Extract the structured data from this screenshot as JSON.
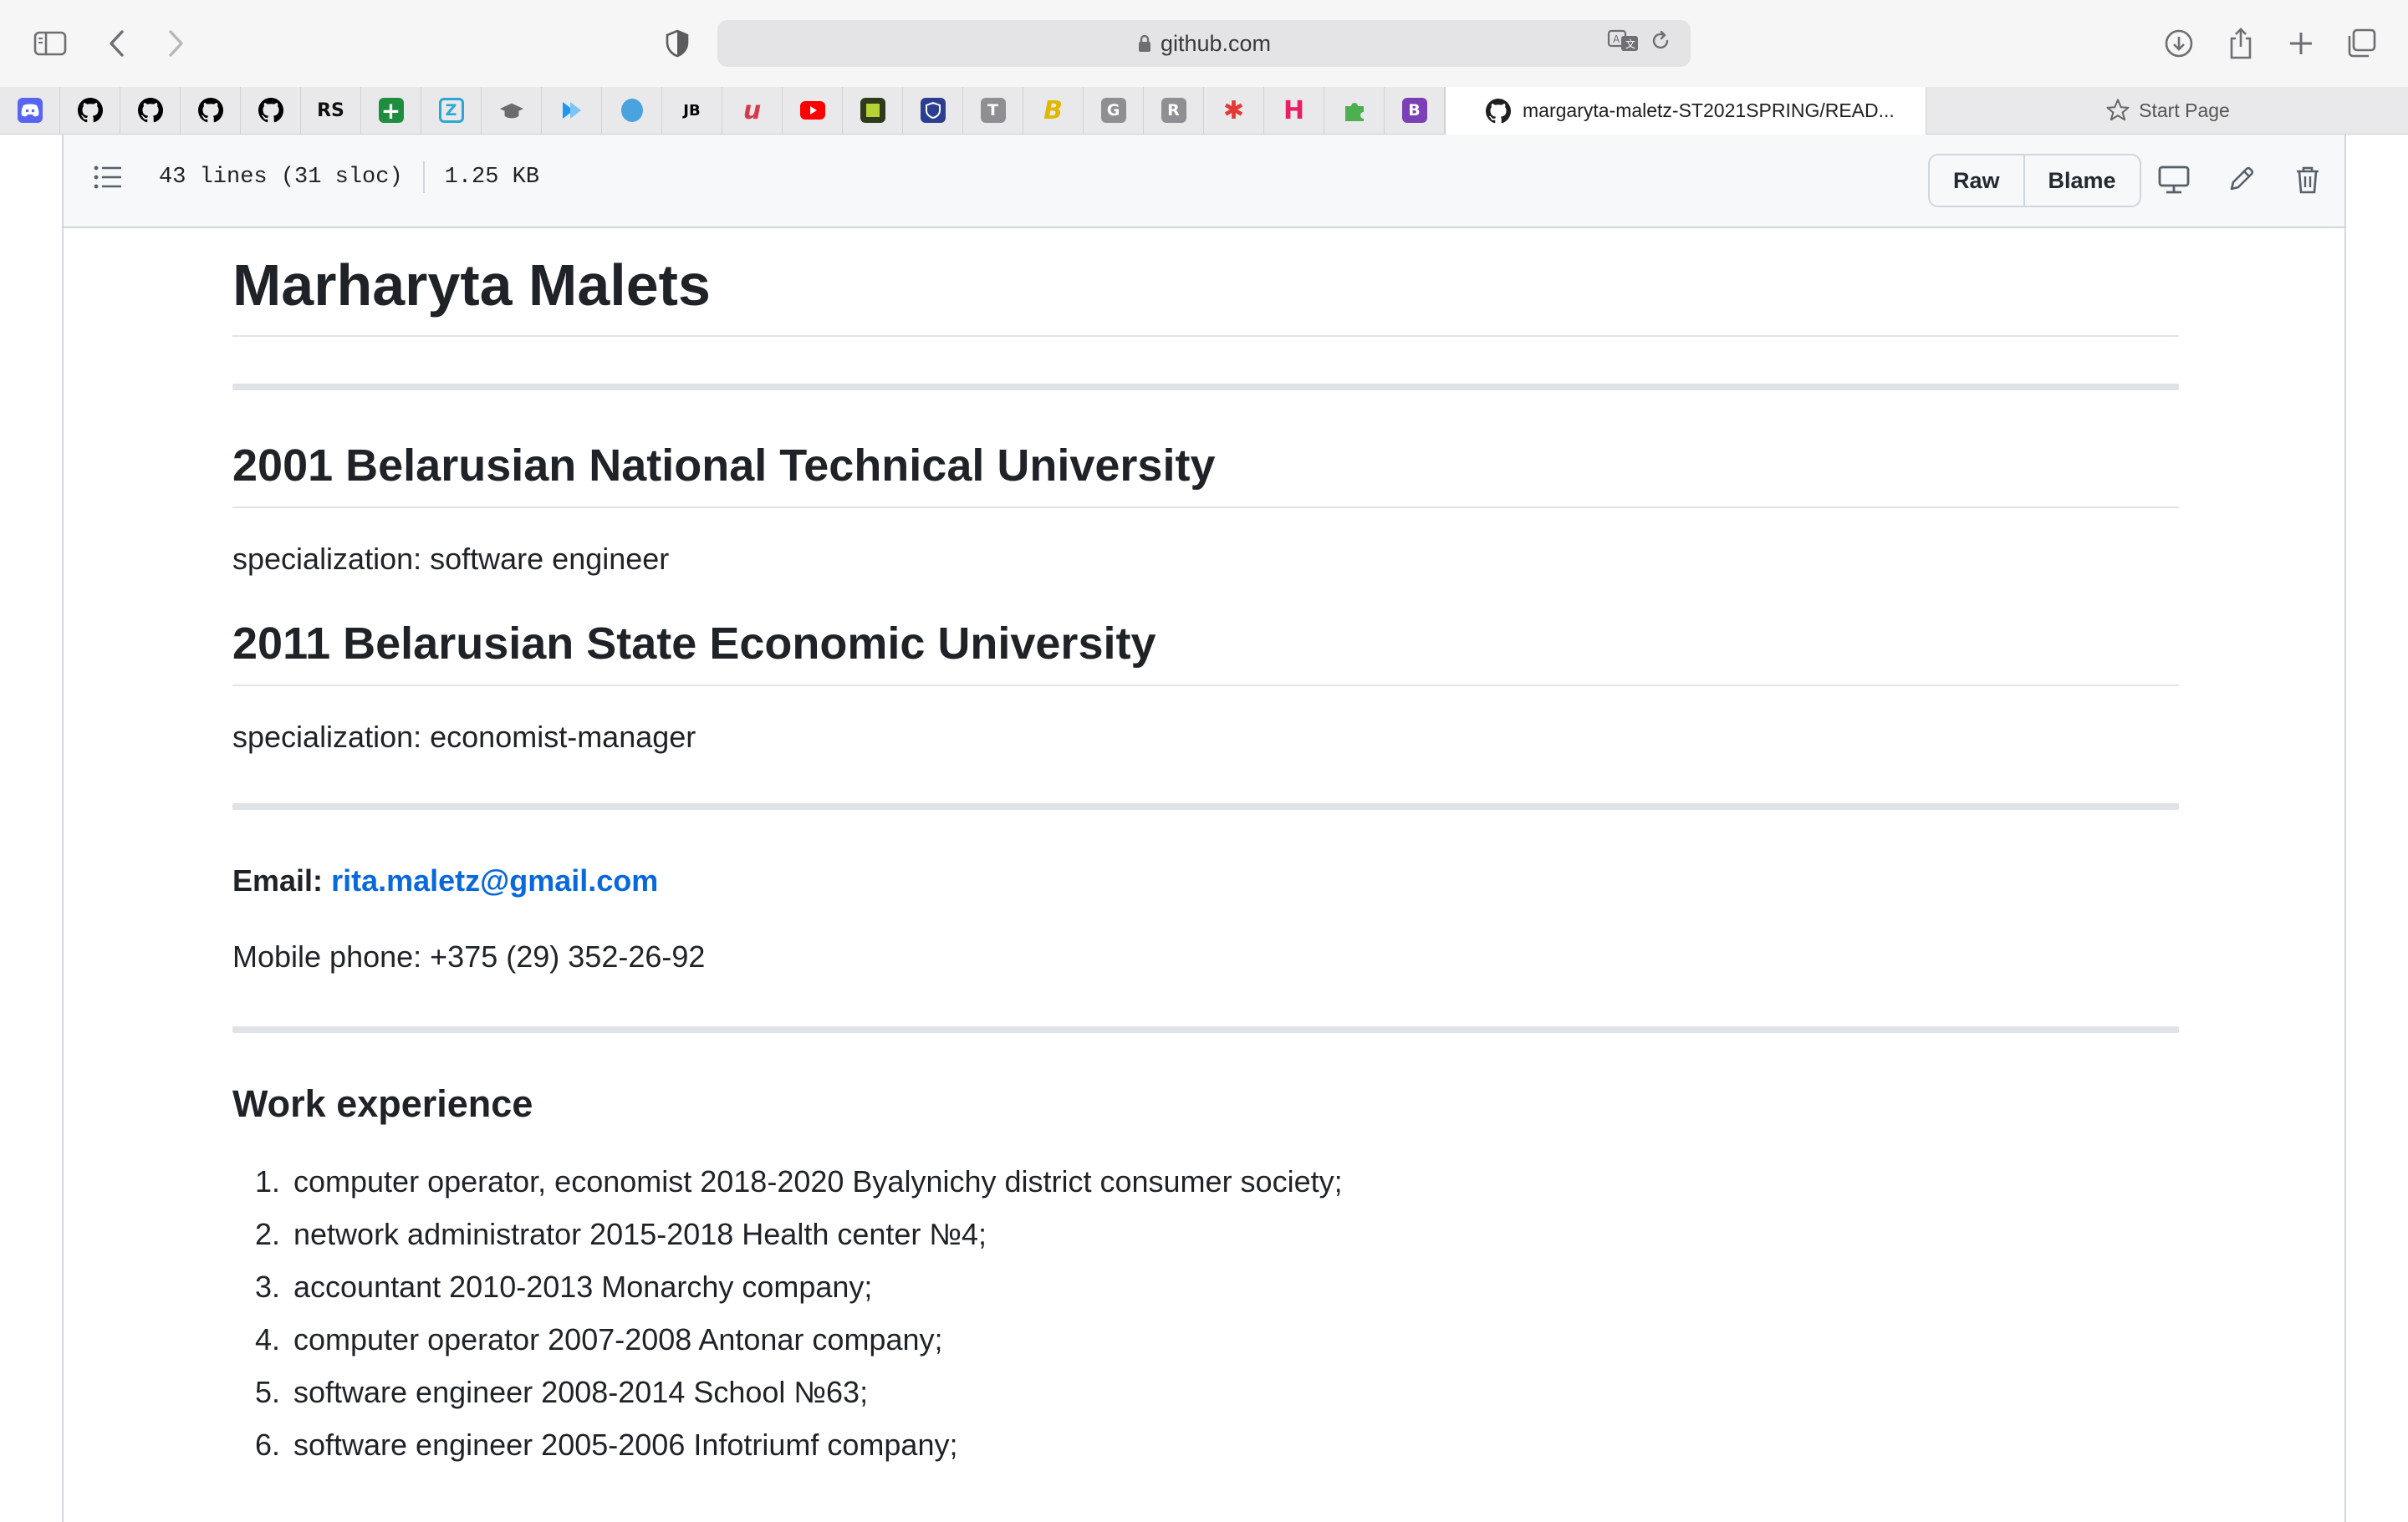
{
  "browser": {
    "url": "github.com",
    "active_tab_title": "margaryta-maletz-ST2021SPRING/READ...",
    "start_page_label": "Start Page",
    "favorites": [
      {
        "name": "discord",
        "glyph": "",
        "color": "#5865f2"
      },
      {
        "name": "github",
        "glyph": "",
        "color": "#000000"
      },
      {
        "name": "github",
        "glyph": "",
        "color": "#000000"
      },
      {
        "name": "github",
        "glyph": "",
        "color": "#000000"
      },
      {
        "name": "github",
        "glyph": "",
        "color": "#000000"
      },
      {
        "name": "rs-school",
        "glyph": "RS",
        "color": "#111111"
      },
      {
        "name": "sheets",
        "glyph": "+",
        "color": "#1e8e3e"
      },
      {
        "name": "z-app",
        "glyph": "Z",
        "color": "#2aa7d6"
      },
      {
        "name": "cap",
        "glyph": "",
        "color": "#6b6b6b"
      },
      {
        "name": "play",
        "glyph": "",
        "color": "#2196f3"
      },
      {
        "name": "blob",
        "glyph": "",
        "color": "#4aa3df"
      },
      {
        "name": "jetbrains",
        "glyph": "JB",
        "color": "#000000"
      },
      {
        "name": "u-logo",
        "glyph": "u",
        "color": "#d73a49"
      },
      {
        "name": "youtube",
        "glyph": "",
        "color": "#ff0000"
      },
      {
        "name": "square",
        "glyph": "",
        "color": "#2f3b1c"
      },
      {
        "name": "shield",
        "glyph": "",
        "color": "#2c3e8f"
      },
      {
        "name": "t-letter",
        "glyph": "T",
        "color": "#8e8e93"
      },
      {
        "name": "b-italic",
        "glyph": "B",
        "color": "#e0b800"
      },
      {
        "name": "g-letter",
        "glyph": "G",
        "color": "#8e8e93"
      },
      {
        "name": "r-letter",
        "glyph": "R",
        "color": "#8e8e93"
      },
      {
        "name": "asterisk",
        "glyph": "✱",
        "color": "#e53935"
      },
      {
        "name": "h-letter",
        "glyph": "H",
        "color": "#e91e63"
      },
      {
        "name": "puzzle",
        "glyph": "",
        "color": "#4caf50"
      },
      {
        "name": "b-box",
        "glyph": "B",
        "color": "#7b3fb6"
      }
    ]
  },
  "file": {
    "lines": "43 lines (31 sloc)",
    "size": "1.25 KB",
    "raw_label": "Raw",
    "blame_label": "Blame"
  },
  "readme": {
    "name": "Marharyta Malets",
    "edu1_title": "2001 Belarusian National Technical University",
    "edu1_spec": "specialization: software engineer",
    "edu2_title": "2011 Belarusian State Economic University",
    "edu2_spec": "specialization: economist-manager",
    "email_label": "Email:",
    "email": "rita.maletz@gmail.com",
    "phone": "Mobile phone: +375 (29) 352-26-92",
    "work_title": "Work experience",
    "work": [
      {
        "num": "1.",
        "text": "computer operator, economist 2018-2020 Byalynichy district consumer society;"
      },
      {
        "num": "2.",
        "text": "network administrator 2015-2018 Health center №4;"
      },
      {
        "num": "3.",
        "text": "accountant 2010-2013 Monarchy company;"
      },
      {
        "num": "4.",
        "text": "computer operator 2007-2008 Antonar company;"
      },
      {
        "num": "5.",
        "text": "software engineer 2008-2014 School №63;"
      },
      {
        "num": "6.",
        "text": "software engineer 2005-2006 Infotriumf company;"
      }
    ]
  }
}
